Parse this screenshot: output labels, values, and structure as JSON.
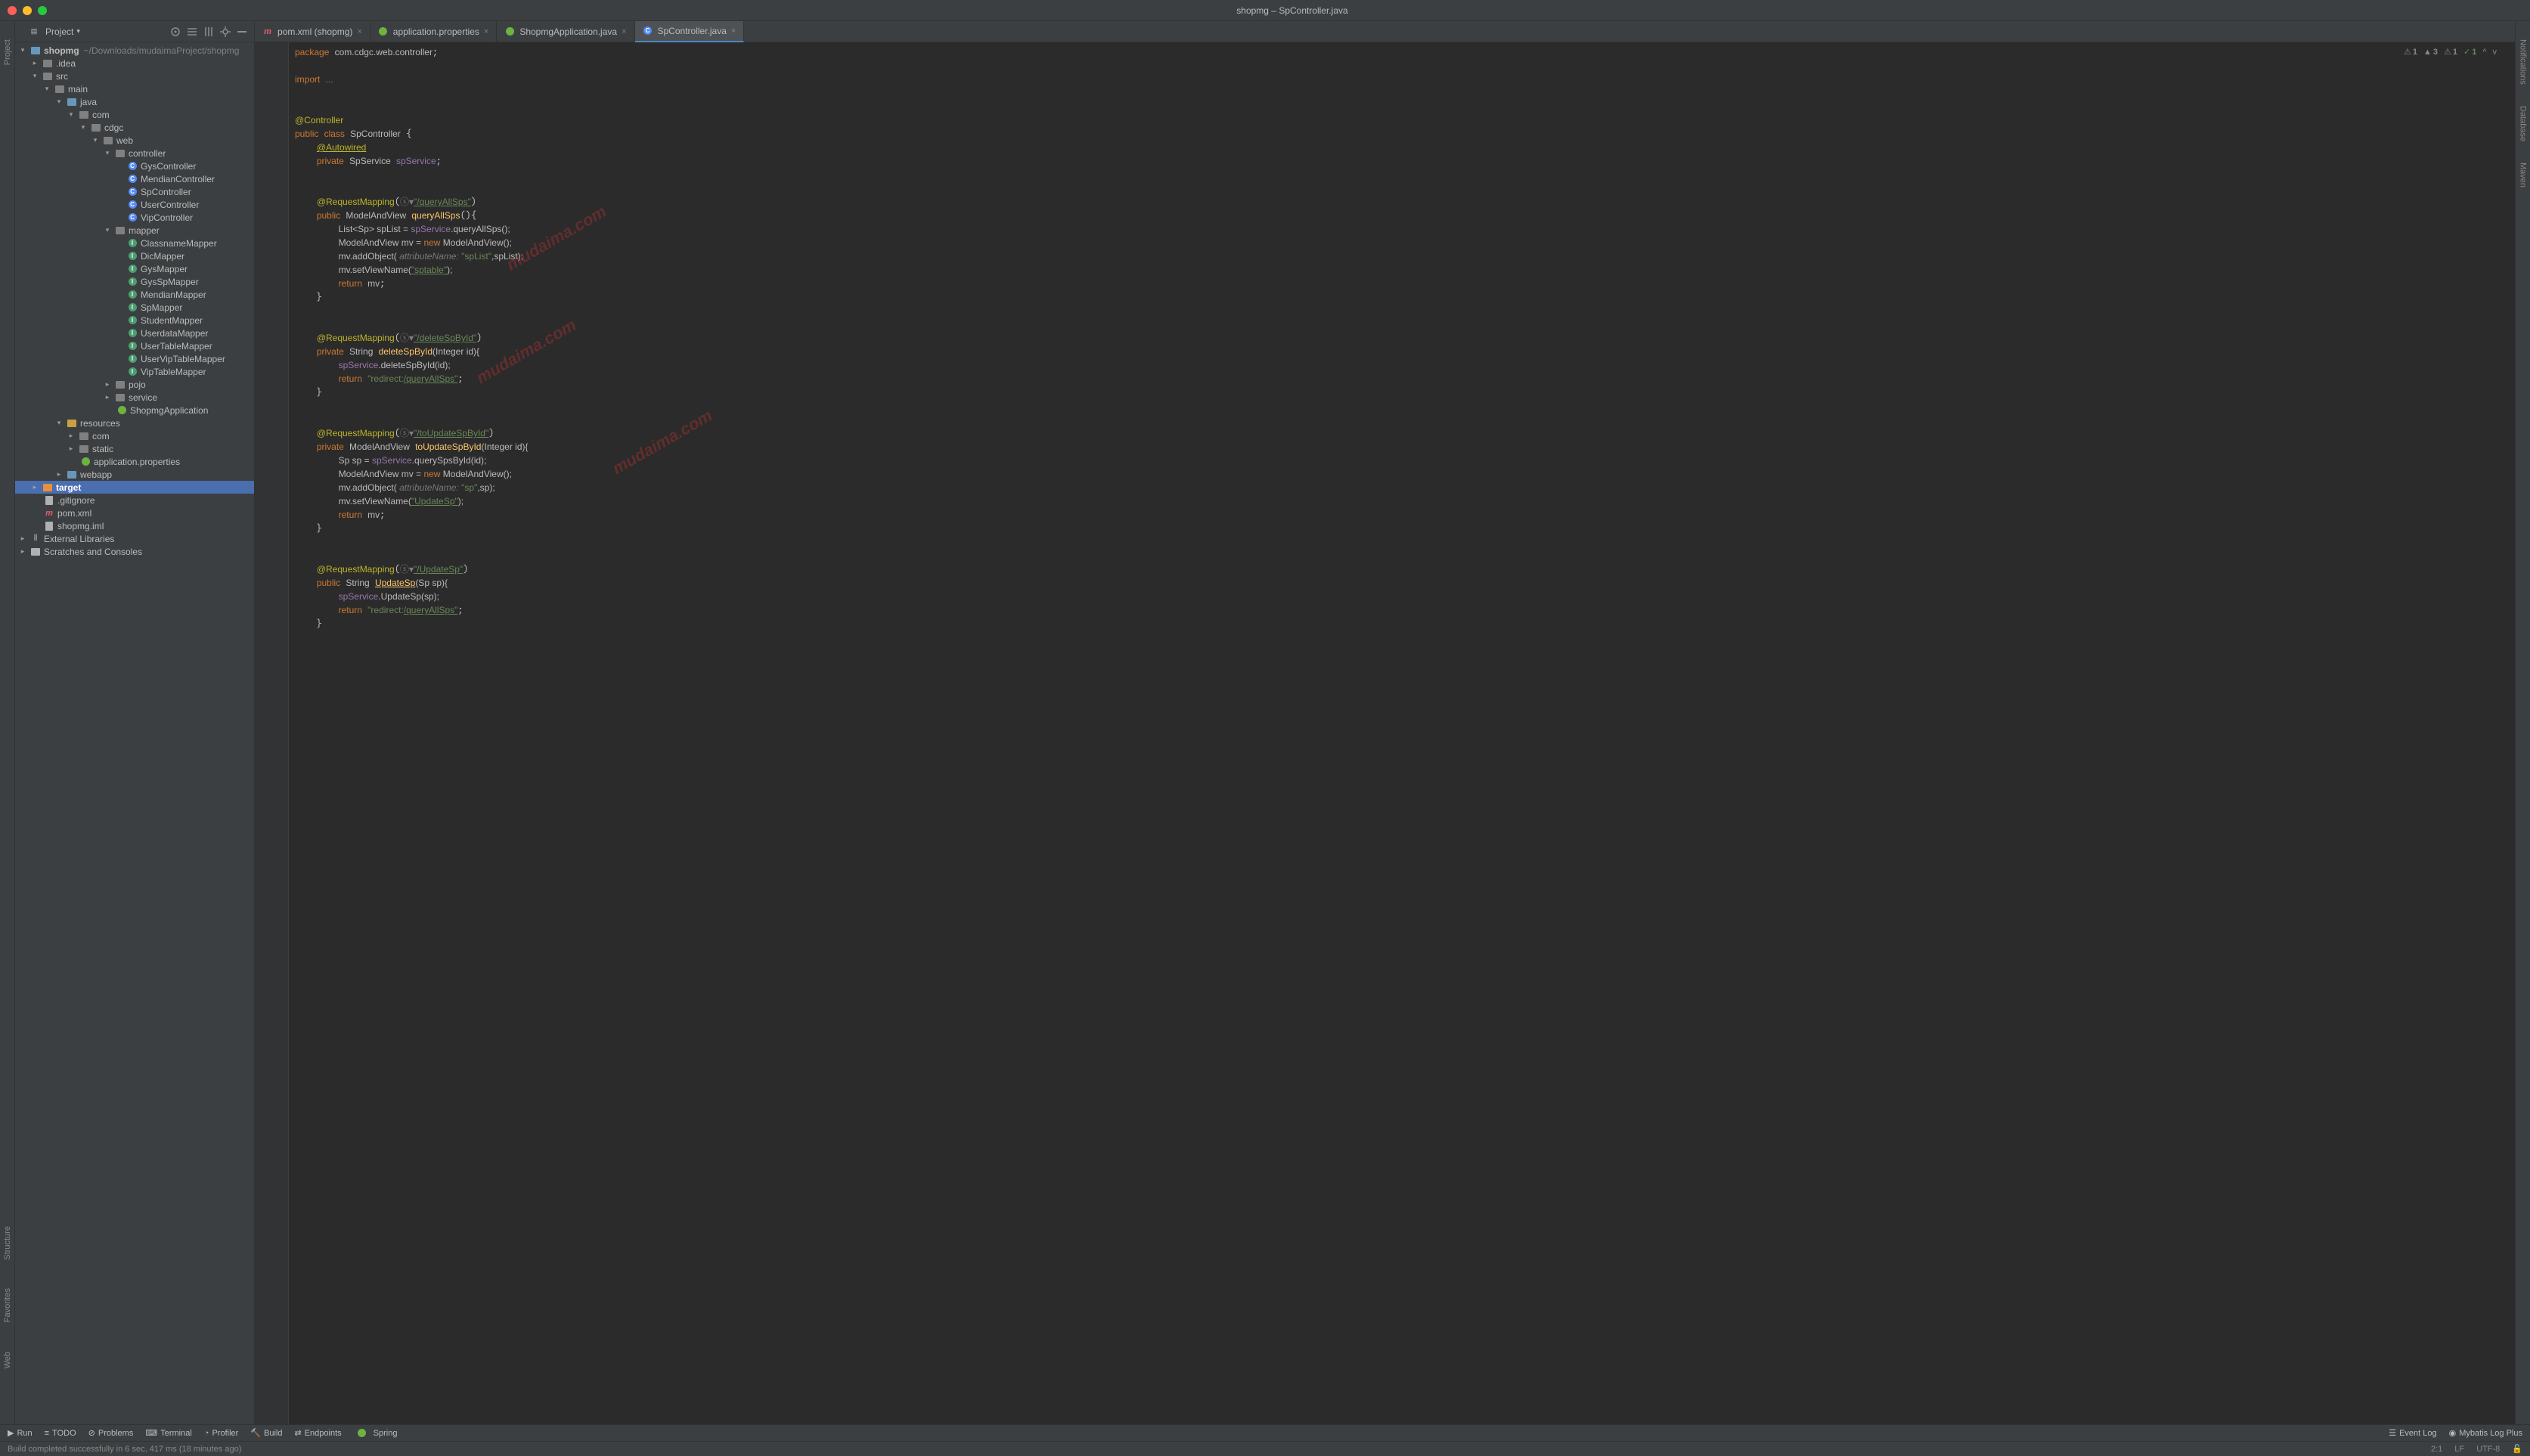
{
  "window_title": "shopmg – SpController.java",
  "project_dropdown": "Project",
  "root": {
    "name": "shopmg",
    "path": "~/Downloads/mudaimaProject/shopmg"
  },
  "tree": {
    "idea": ".idea",
    "src": "src",
    "main": "main",
    "java": "java",
    "com": "com",
    "cdgc": "cdgc",
    "web": "web",
    "controller": "controller",
    "GysController": "GysController",
    "MendianController": "MendianController",
    "SpController": "SpController",
    "UserController": "UserController",
    "VipController": "VipController",
    "mapper": "mapper",
    "ClassnameMapper": "ClassnameMapper",
    "DicMapper": "DicMapper",
    "GysMapper": "GysMapper",
    "GysSpMapper": "GysSpMapper",
    "MendianMapper": "MendianMapper",
    "SpMapper": "SpMapper",
    "StudentMapper": "StudentMapper",
    "UserdataMapper": "UserdataMapper",
    "UserTableMapper": "UserTableMapper",
    "UserVipTableMapper": "UserVipTableMapper",
    "VipTableMapper": "VipTableMapper",
    "pojo": "pojo",
    "service": "service",
    "ShopmgApplication": "ShopmgApplication",
    "resources": "resources",
    "com2": "com",
    "static": "static",
    "appprops": "application.properties",
    "webapp": "webapp",
    "target": "target",
    "gitignore": ".gitignore",
    "pom": "pom.xml",
    "iml": "shopmg.iml",
    "extlib": "External Libraries",
    "scratches": "Scratches and Consoles"
  },
  "tabs": [
    {
      "label": "pom.xml (shopmg)",
      "active": false
    },
    {
      "label": "application.properties",
      "active": false
    },
    {
      "label": "ShopmgApplication.java",
      "active": false
    },
    {
      "label": "SpController.java",
      "active": true
    }
  ],
  "insp": {
    "w1": "1",
    "w2": "3",
    "w3": "1",
    "w4": "1"
  },
  "rail": {
    "project": "Project",
    "structure": "Structure",
    "favorites": "Favorites",
    "web": "Web",
    "notifications": "Notifications",
    "database": "Database",
    "maven": "Maven"
  },
  "bottom": {
    "run": "Run",
    "todo": "TODO",
    "problems": "Problems",
    "terminal": "Terminal",
    "profiler": "Profiler",
    "build": "Build",
    "endpoints": "Endpoints",
    "spring": "Spring",
    "eventlog": "Event Log",
    "mybatis": "Mybatis Log Plus"
  },
  "status": {
    "msg": "Build completed successfully in 6 sec, 417 ms (18 minutes ago)",
    "pos": "2:1",
    "le": "LF",
    "enc": "UTF-8"
  },
  "code": {
    "pkg": "package",
    "pkg_name": "com.cdgc.web.controller",
    "import": "import",
    "import_dots": "...",
    "anno_controller": "@Controller",
    "public": "public",
    "class": "class",
    "SpController": "SpController",
    "Autowired": "@Autowired",
    "private": "private",
    "SpService": "SpService",
    "spService": "spService",
    "RequestMapping": "@RequestMapping",
    "queryAllSps_url": "\"/queryAllSps\"",
    "MAV": "ModelAndView",
    "queryAllSps": "queryAllSps",
    "ListSp": "List<Sp> spList = ",
    "queryAllSpsCall": ".queryAllSps();",
    "mvNew": " mv = ",
    "new": "new",
    "mvCtor": " ModelAndView();",
    "addObj1": "mv.addObject( ",
    "attrName": "attributeName:",
    "spListStr": " \"spList\"",
    "spListEnd": ",spList);",
    "setView1": "mv.setViewName(",
    "sptable": "\"sptable\"",
    "closeParen": ");",
    "return": "return",
    "mv": "mv",
    "deleteSpById_url": "\"/deleteSpById\"",
    "String": "String",
    "deleteSpById": "deleteSpById",
    "IntegerId": "(Integer id){",
    "delCall": ".deleteSpById(id);",
    "redirectAll": "\"redirect:",
    "redirectAllPath": "/queryAllSps\"",
    "toUpdate_url": "\"/toUpdateSpById\"",
    "toUpdateSpById": "toUpdateSpById",
    "SpSp": "Sp sp = ",
    "querySpsById": ".querySpsById(id);",
    "spStr": " \"sp\"",
    "spEnd": ",sp);",
    "UpdateSp": "\"UpdateSp\"",
    "UpdateSp_url": "\"/UpdateSp\"",
    "UpdateSpFn": "UpdateSp",
    "UpdateSpSig": "(Sp sp){",
    "UpdateSpCall": ".UpdateSp(sp);"
  },
  "watermark": "mudaima.com"
}
